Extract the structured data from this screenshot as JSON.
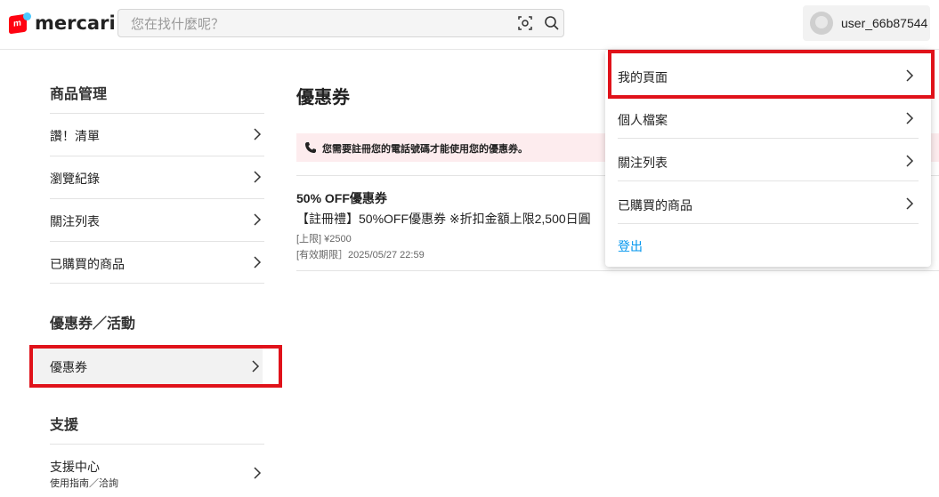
{
  "header": {
    "logo_text": "mercari",
    "logo_mark": "m",
    "search_placeholder": "您在找什麼呢？",
    "username": "user_66b87544"
  },
  "sidebar": {
    "sections": [
      {
        "title": "商品管理",
        "items": [
          {
            "label": "讚！清單"
          },
          {
            "label": "瀏覽紀錄"
          },
          {
            "label": "關注列表"
          },
          {
            "label": "已購買的商品"
          }
        ]
      },
      {
        "title": "優惠券／活動",
        "items": [
          {
            "label": "優惠券",
            "selected": true
          }
        ]
      },
      {
        "title": "支援",
        "items": [
          {
            "label": "支援中心",
            "sublabel": "使用指南／洽詢"
          }
        ]
      }
    ]
  },
  "main": {
    "title": "優惠券",
    "notice": "您需要註冊您的電話號碼才能使用您的優惠券。",
    "coupon": {
      "title": "50% OFF優惠券",
      "description": "【註冊禮】50%OFF優惠券 ※折扣金額上限2,500日圓",
      "limit": "[上限] ¥2500",
      "expiry": "[有效期限］2025/05/27 22:59"
    }
  },
  "dropdown": {
    "items": [
      {
        "label": "我的頁面",
        "highlighted": true
      },
      {
        "label": "個人檔案"
      },
      {
        "label": "關注列表"
      },
      {
        "label": "已購買的商品"
      }
    ],
    "logout": "登出"
  },
  "colors": {
    "brand_red": "#ff0211",
    "brand_blue": "#4dc9ff",
    "highlight_border": "#e0121a",
    "notice_bg": "#fdecee",
    "link_blue": "#0095ee"
  },
  "icons": [
    "search-icon",
    "camera-scan-icon",
    "avatar-icon",
    "chevron-right-icon",
    "phone-icon"
  ]
}
